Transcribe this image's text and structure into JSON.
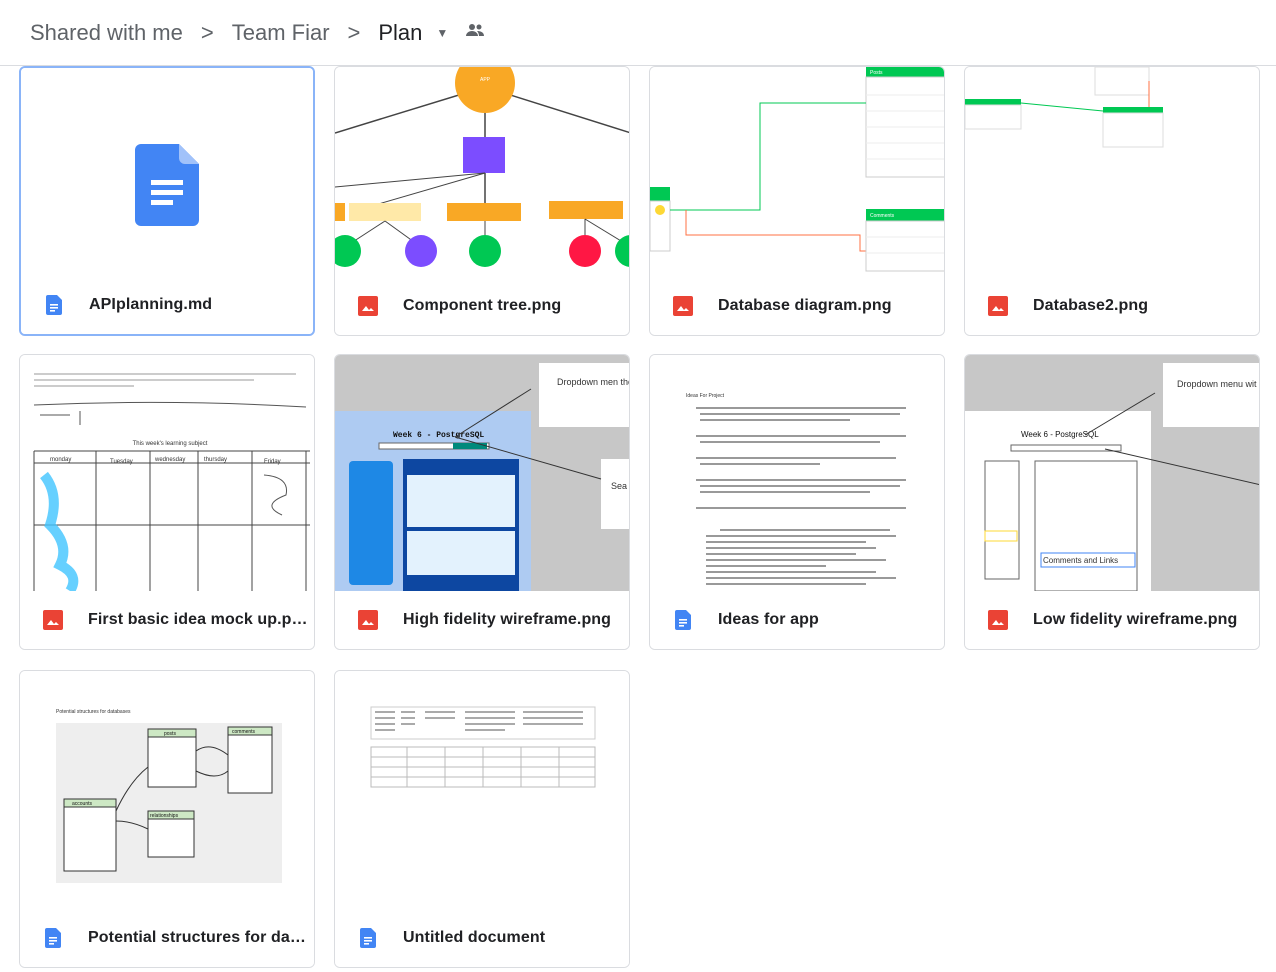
{
  "breadcrumb": {
    "items": [
      "Shared with me",
      "Team Fiar",
      "Plan"
    ],
    "separator": ">"
  },
  "colors": {
    "doc_blue": "#4285f4",
    "image_red": "#ea4335",
    "selected_border": "#8ab4f8"
  },
  "files": [
    {
      "name": "APIplanning.md",
      "icon": "doc-icon"
    },
    {
      "name": "Component tree.png",
      "icon": "image-icon"
    },
    {
      "name": "Database diagram.png",
      "icon": "image-icon"
    },
    {
      "name": "Database2.png",
      "icon": "image-icon"
    },
    {
      "name": "First basic idea mock up.png",
      "icon": "image-icon"
    },
    {
      "name": "High fidelity wireframe.png",
      "icon": "image-icon"
    },
    {
      "name": "Ideas for app",
      "icon": "doc-icon"
    },
    {
      "name": "Low fidelity wireframe.png",
      "icon": "image-icon"
    },
    {
      "name": "Potential structures for dat...",
      "icon": "doc-icon"
    },
    {
      "name": "Untitled document",
      "icon": "doc-icon"
    }
  ],
  "thumb_text": {
    "app_node": "APP",
    "comments_table": "Comments",
    "posts_table": "Posts",
    "week_title": "Week 6 - PostgreSQL",
    "dropdown_note_1": "Dropdown men the weeks do fo name of subjec",
    "dropdown_note_2": "Dropdown menu wit weeks do far (and n subject)",
    "search_note": "Sea",
    "ideas_title": "Ideas For Project",
    "comments_and_links": "Comments and Links",
    "structures_title": "Potential structures for databases",
    "mock_title": "This week's learning subject",
    "mock_days": [
      "monday",
      "Tuesday",
      "wednesday",
      "thursday",
      "Friday"
    ],
    "posts_label": "posts",
    "comments_label": "comments",
    "accounts_label": "accounts",
    "relationships_label": "relationships"
  }
}
